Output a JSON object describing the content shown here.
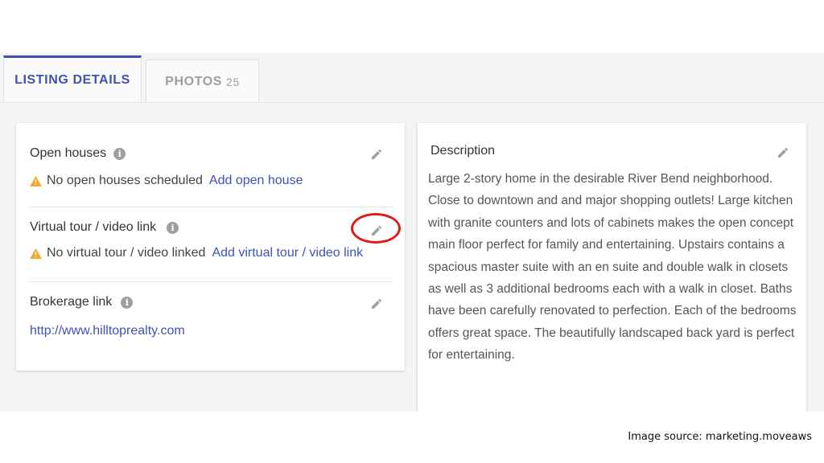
{
  "tabs": [
    {
      "label": "LISTING DETAILS",
      "active": true
    },
    {
      "label": "PHOTOS",
      "count": "25",
      "active": false
    }
  ],
  "open_houses": {
    "title": "Open houses",
    "status": "No open houses scheduled",
    "action": "Add open house"
  },
  "virtual_tour": {
    "title": "Virtual tour / video link",
    "status": "No virtual tour / video linked",
    "action": "Add virtual tour / video link"
  },
  "brokerage": {
    "title": "Brokerage link",
    "url": "http://www.hilltoprealty.com"
  },
  "description": {
    "title": "Description",
    "text": "Large 2-story home in the desirable River Bend neighborhood. Close to downtown and and major shopping outlets!  Large kitchen with granite counters and lots of cabinets makes the open concept main floor perfect for family and entertaining. Upstairs contains a spacious master suite with an en suite and double walk in closets as well as 3 additional bedrooms each with a walk in closet.  Baths have been carefully renovated to perfection.  Each of the bedrooms offers great space.  The beautifully landscaped back yard is perfect for entertaining."
  },
  "image_credit": "Image source: marketing.moveaws",
  "colors": {
    "accent": "#3f51b5",
    "warning": "#f0a830",
    "highlight_circle": "#e01919"
  },
  "icons": {
    "info": "info-icon",
    "edit": "pencil-icon",
    "warning": "warning-icon"
  }
}
